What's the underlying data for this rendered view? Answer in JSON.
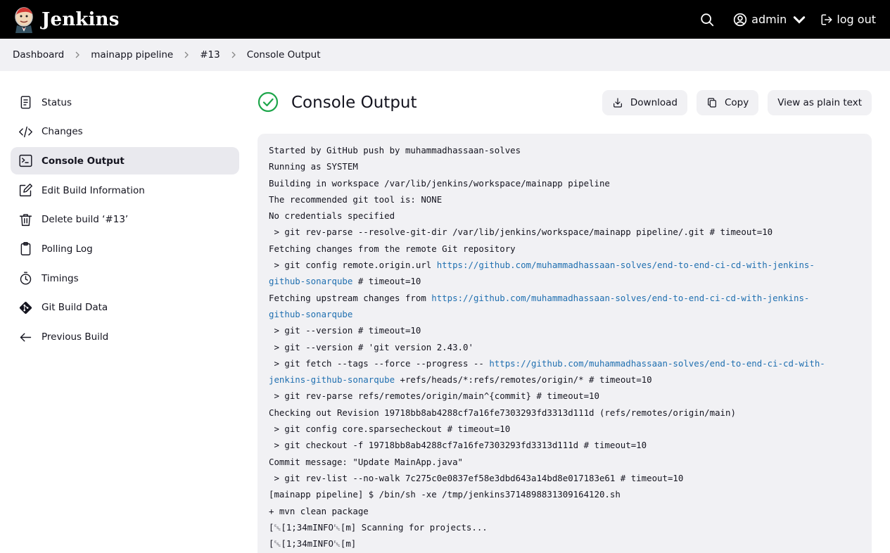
{
  "header": {
    "brand": "Jenkins",
    "user": "admin",
    "logout": "log out",
    "icons": [
      "search-icon",
      "user-icon",
      "chevron-down-icon",
      "logout-icon"
    ]
  },
  "breadcrumb": [
    "Dashboard",
    "mainapp pipeline",
    "#13",
    "Console Output"
  ],
  "sidebar": {
    "items": [
      {
        "label": "Status",
        "icon": "status-icon",
        "active": false
      },
      {
        "label": "Changes",
        "icon": "code-icon",
        "active": false
      },
      {
        "label": "Console Output",
        "icon": "terminal-icon",
        "active": true
      },
      {
        "label": "Edit Build Information",
        "icon": "edit-icon",
        "active": false
      },
      {
        "label": "Delete build ‘#13’",
        "icon": "trash-icon",
        "active": false
      },
      {
        "label": "Polling Log",
        "icon": "clipboard-icon",
        "active": false
      },
      {
        "label": "Timings",
        "icon": "stopwatch-icon",
        "active": false
      },
      {
        "label": "Git Build Data",
        "icon": "git-icon",
        "active": false
      },
      {
        "label": "Previous Build",
        "icon": "arrow-left-icon",
        "active": false
      }
    ]
  },
  "main": {
    "title": "Console Output",
    "status": "success",
    "actions": {
      "download": "Download",
      "copy": "Copy",
      "plain": "View as plain text"
    }
  },
  "console": {
    "lines": [
      [
        {
          "t": "Started by GitHub push by muhammadhassaan-solves"
        }
      ],
      [
        {
          "t": "Running as SYSTEM"
        }
      ],
      [
        {
          "t": "Building in workspace /var/lib/jenkins/workspace/mainapp pipeline"
        }
      ],
      [
        {
          "t": "The recommended git tool is: NONE"
        }
      ],
      [
        {
          "t": "No credentials specified"
        }
      ],
      [
        {
          "t": " > git rev-parse --resolve-git-dir /var/lib/jenkins/workspace/mainapp pipeline/.git # timeout=10"
        }
      ],
      [
        {
          "t": "Fetching changes from the remote Git repository"
        }
      ],
      [
        {
          "t": " > git config remote.origin.url "
        },
        {
          "t": "https://github.com/muhammadhassaan-solves/end-to-end-ci-cd-with-jenkins-",
          "link": true
        }
      ],
      [
        {
          "t": "github-sonarqube",
          "link": true
        },
        {
          "t": " # timeout=10"
        }
      ],
      [
        {
          "t": "Fetching upstream changes from "
        },
        {
          "t": "https://github.com/muhammadhassaan-solves/end-to-end-ci-cd-with-jenkins-",
          "link": true
        }
      ],
      [
        {
          "t": "github-sonarqube",
          "link": true
        }
      ],
      [
        {
          "t": " > git --version # timeout=10"
        }
      ],
      [
        {
          "t": " > git --version # 'git version 2.43.0'"
        }
      ],
      [
        {
          "t": " > git fetch --tags --force --progress -- "
        },
        {
          "t": "https://github.com/muhammadhassaan-solves/end-to-end-ci-cd-with-",
          "link": true
        }
      ],
      [
        {
          "t": "jenkins-github-sonarqube",
          "link": true
        },
        {
          "t": " +refs/heads/*:refs/remotes/origin/* # timeout=10"
        }
      ],
      [
        {
          "t": " > git rev-parse refs/remotes/origin/main^{commit} # timeout=10"
        }
      ],
      [
        {
          "t": "Checking out Revision 19718bb8ab4288cf7a16fe7303293fd3313d111d (refs/remotes/origin/main)"
        }
      ],
      [
        {
          "t": " > git config core.sparsecheckout # timeout=10"
        }
      ],
      [
        {
          "t": " > git checkout -f 19718bb8ab4288cf7a16fe7303293fd3313d111d # timeout=10"
        }
      ],
      [
        {
          "t": "Commit message: \"Update MainApp.java\""
        }
      ],
      [
        {
          "t": " > git rev-list --no-walk 7c275c0e0837ef58e3dbd643a14bd8e017183e61 # timeout=10"
        }
      ],
      [
        {
          "t": "[mainapp pipeline] $ /bin/sh -xe /tmp/jenkins3714898831309164120.sh"
        }
      ],
      [
        {
          "t": "+ mvn clean package"
        }
      ],
      [
        {
          "t": "[␛[1;34mINFO␛[m] Scanning for projects..."
        }
      ],
      [
        {
          "t": "[␛[1;34mINFO␛[m]"
        }
      ]
    ]
  }
}
